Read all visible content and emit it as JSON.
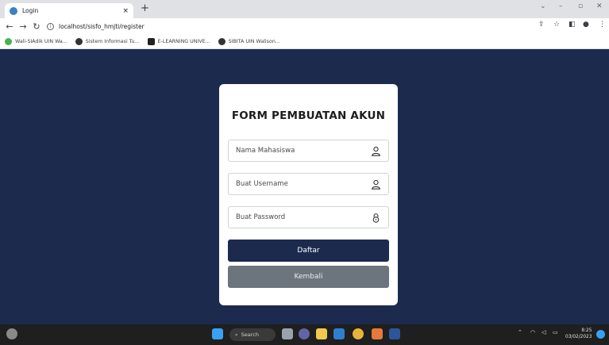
{
  "browser": {
    "tab_title": "Login",
    "tab_close": "×",
    "new_tab": "+",
    "url": "localhost/sisfo_hmjti/register",
    "bookmarks": [
      {
        "label": "Wali-SIAdik UIN Wa...",
        "color": "#4caf50"
      },
      {
        "label": "Sistem Informasi Tu...",
        "color": "#333333"
      },
      {
        "label": "E-LEARNING UNIVE...",
        "color": "#222222"
      },
      {
        "label": "SIBITA UIN Walison...",
        "color": "#333333"
      }
    ]
  },
  "form": {
    "title": "FORM PEMBUATAN AKUN",
    "name_placeholder": "Nama Mahasiswa",
    "username_placeholder": "Buat Username",
    "password_placeholder": "Buat Password",
    "submit_label": "Daftar",
    "back_label": "Kembali"
  },
  "taskbar": {
    "search_label": "Search",
    "time": "8:25",
    "date": "03/02/2023"
  },
  "colors": {
    "background": "#1c2a4e",
    "primary_button": "#1c2a4e",
    "secondary_button": "#6c757d"
  }
}
